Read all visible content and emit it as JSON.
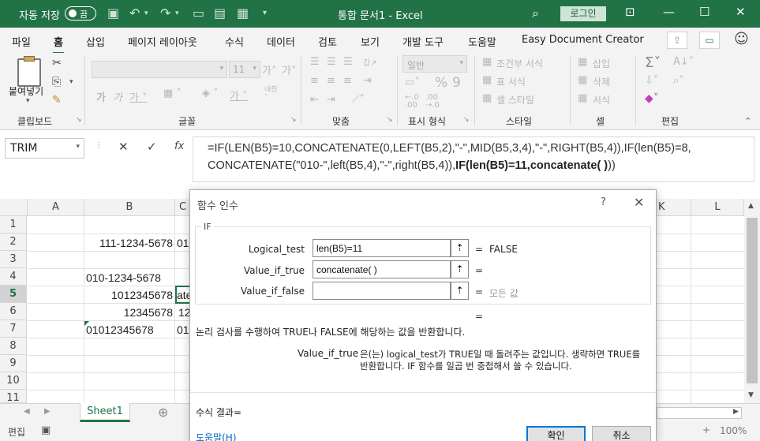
{
  "titlebar": {
    "autosave_label": "자동 저장",
    "autosave_state": "끔",
    "doc_title": "통합 문서1  -  Excel",
    "login": "로그인"
  },
  "menu": {
    "tabs": [
      "파일",
      "홈",
      "삽입",
      "페이지 레이아웃",
      "수식",
      "데이터",
      "검토",
      "보기",
      "개발 도구",
      "도움말",
      "Easy Document Creator"
    ]
  },
  "ribbon": {
    "groups": {
      "clipboard": "클립보드",
      "font": "글꼴",
      "align": "맞춤",
      "number": "표시 형식",
      "style": "스타일",
      "cells": "셀",
      "edit": "편집"
    },
    "paste_label": "붙여넣기",
    "font_size": "11",
    "number_format": "일반",
    "style_items": [
      "조건부 서식",
      "표 서식",
      "셀 스타일"
    ],
    "cell_items": [
      "삽입",
      "삭제",
      "서식"
    ]
  },
  "formula_bar": {
    "name_box": "TRIM",
    "fx": "fx",
    "line1": "=IF(LEN(B5)=10,CONCATENATE(0,LEFT(B5,2),\"-\",MID(B5,3,4),\"-\",RIGHT(B5,4)),IF(len(B5)=8,",
    "line2_plain": "CONCATENATE(\"010-\",left(B5,4),\"-\",right(B5,4)),",
    "line2_bold": "IF(len(B5)=11,concatenate( )",
    "line2_tail": "))"
  },
  "grid": {
    "columns": [
      "A",
      "B",
      "C",
      "K",
      "L"
    ],
    "rows": [
      "1",
      "2",
      "3",
      "4",
      "5",
      "6",
      "7",
      "8",
      "9",
      "10",
      "11"
    ],
    "cells": {
      "B2": "111-1234-5678",
      "C2": "01",
      "B4": "010-1234-5678",
      "B5": "1012345678",
      "C5": "ate",
      "B6": "12345678",
      "C6": "12",
      "B7": "01012345678",
      "C7": "01"
    }
  },
  "sheets": {
    "tabs": [
      "Sheet1"
    ],
    "add": "⊕"
  },
  "status": {
    "mode": "편집",
    "zoom": "100%"
  },
  "dialog": {
    "title": "함수 인수",
    "help_glyph": "?",
    "function_name": "IF",
    "args": [
      {
        "label": "Logical_test",
        "value": "len(B5)=11",
        "result": "FALSE"
      },
      {
        "label": "Value_if_true",
        "value": "concatenate( )",
        "result": ""
      },
      {
        "label": "Value_if_false",
        "value": "",
        "result": "모든 값"
      }
    ],
    "total_eq": "=",
    "description": "논리 검사를 수행하여 TRUE나 FALSE에 해당하는 값을 반환합니다.",
    "arg_help_name": "Value_if_true",
    "arg_help_text_1": "은(는) logical_test가 TRUE일 때 돌려주는 값입니다. 생략하면 TRUE를",
    "arg_help_text_2": "반환합니다. IF 함수를 일곱 번 중첩해서 쓸 수 있습니다.",
    "formula_result_label": "수식 결과=",
    "help_link": "도움말(H)",
    "ok": "확인",
    "cancel": "취소"
  }
}
